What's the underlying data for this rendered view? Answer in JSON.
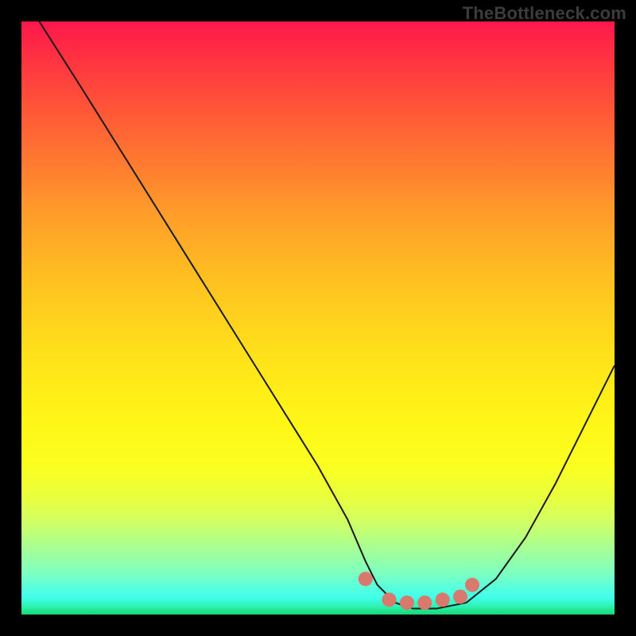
{
  "watermark": "TheBottleneck.com",
  "colors": {
    "background": "#000000",
    "curve": "#1a1a1a",
    "marker": "#d9786d"
  },
  "chart_data": {
    "type": "line",
    "title": "",
    "xlabel": "",
    "ylabel": "",
    "xlim": [
      0,
      100
    ],
    "ylim": [
      0,
      100
    ],
    "series": [
      {
        "name": "bottleneck-curve",
        "x": [
          3,
          10,
          20,
          30,
          40,
          50,
          55,
          58,
          60,
          63,
          66,
          70,
          75,
          80,
          85,
          90,
          95,
          100
        ],
        "y": [
          100,
          89,
          73,
          57,
          41,
          25,
          16,
          9,
          5,
          2,
          1,
          1,
          2,
          6,
          13,
          22,
          32,
          42
        ]
      }
    ],
    "markers": {
      "name": "bottom-dots",
      "points": [
        {
          "x": 58,
          "y": 6
        },
        {
          "x": 62,
          "y": 2.5
        },
        {
          "x": 65,
          "y": 2
        },
        {
          "x": 68,
          "y": 2
        },
        {
          "x": 71,
          "y": 2.5
        },
        {
          "x": 74,
          "y": 3
        },
        {
          "x": 76,
          "y": 5
        }
      ]
    }
  }
}
